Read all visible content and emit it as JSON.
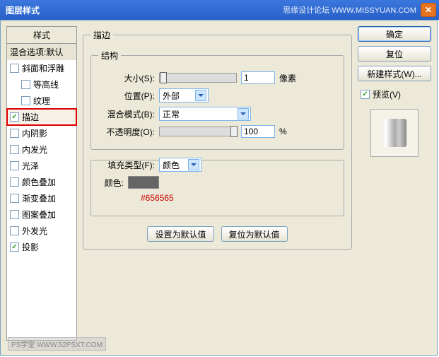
{
  "titlebar": {
    "title": "图层样式",
    "site": "思缘设计论坛  WWW.MISSYUAN.COM"
  },
  "styles": {
    "header": "样式",
    "blend": "混合选项:默认",
    "items": [
      {
        "label": "斜面和浮雕",
        "checked": false,
        "indent": false
      },
      {
        "label": "等高线",
        "checked": false,
        "indent": true
      },
      {
        "label": "纹理",
        "checked": false,
        "indent": true
      },
      {
        "label": "描边",
        "checked": true,
        "indent": false,
        "selected": true
      },
      {
        "label": "内阴影",
        "checked": false,
        "indent": false
      },
      {
        "label": "内发光",
        "checked": false,
        "indent": false
      },
      {
        "label": "光泽",
        "checked": false,
        "indent": false
      },
      {
        "label": "颜色叠加",
        "checked": false,
        "indent": false
      },
      {
        "label": "渐变叠加",
        "checked": false,
        "indent": false
      },
      {
        "label": "图案叠加",
        "checked": false,
        "indent": false
      },
      {
        "label": "外发光",
        "checked": false,
        "indent": false
      },
      {
        "label": "投影",
        "checked": true,
        "indent": false
      }
    ]
  },
  "stroke": {
    "legend": "描边",
    "structure_legend": "结构",
    "size_label": "大小(S):",
    "size_value": "1",
    "px": "像素",
    "position_label": "位置(P):",
    "position_value": "外部",
    "blendmode_label": "混合模式(B):",
    "blendmode_value": "正常",
    "opacity_label": "不透明度(O):",
    "opacity_value": "100",
    "pct": "%",
    "filltype_label": "填充类型(F):",
    "filltype_value": "颜色",
    "color_label": "颜色:",
    "hex": "#656565",
    "default_set": "设置为默认值",
    "default_reset": "复位为默认值"
  },
  "right": {
    "ok": "确定",
    "cancel": "复位",
    "newstyle": "新建样式(W)...",
    "preview_label": "预览(V)"
  },
  "watermark": "PS学堂  WWW.52PSXT.COM"
}
